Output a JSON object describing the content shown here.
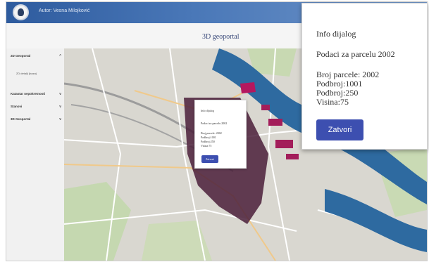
{
  "header": {
    "author": "Autor: Vesna Milojković"
  },
  "page": {
    "title": "3D geoportal"
  },
  "sidebar": {
    "items": [
      {
        "label": "2D Geoportal",
        "chevron": "^"
      },
      {
        "label": "Katastar nepokretnosti",
        "chevron": "v"
      },
      {
        "label": "Stanovi",
        "chevron": "v"
      },
      {
        "label": "3D Geoportal",
        "chevron": "v"
      }
    ],
    "subitems": [
      {
        "label": "2D detalji (baza)"
      }
    ]
  },
  "dialog_small": {
    "title": "Info dijalog",
    "subtitle": "Podaci za parcelu 2002",
    "lines": [
      "Broj parcele: 2002",
      "Podbroj:1001",
      "Podbroj:250",
      "Visina:75"
    ],
    "button": "Zatvori"
  },
  "dialog_large": {
    "title": "Info dijalog",
    "subtitle": "Podaci za parcelu 2002",
    "lines": [
      "Broj parcele: 2002",
      "Podbroj:1001",
      "Podbroj:250",
      "Visina:75"
    ],
    "button": "Zatvori"
  },
  "colors": {
    "header": "#3a67a8",
    "button": "#3d4fb0",
    "river": "#2e6aa0",
    "parcels": "#4a1f3a",
    "map_bg": "#d8d6cf"
  },
  "icons": {
    "logo": "coat-of-arms-logo-icon",
    "chevron_up": "chevron-up-icon",
    "chevron_down": "chevron-down-icon"
  }
}
